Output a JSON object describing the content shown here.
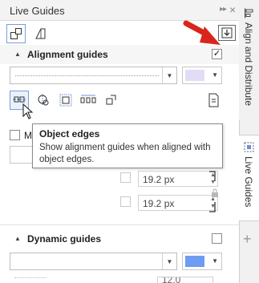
{
  "window": {
    "title": "Live Guides"
  },
  "side_tabs": {
    "align_distribute": "Align and Distribute",
    "live_guides": "Live Guides",
    "add": "+"
  },
  "alignment_section": {
    "label": "Alignment guides",
    "enabled": true,
    "checkbox_mark": "✓",
    "color_hex": "#e3dcf6"
  },
  "alignment_partial_label": "M",
  "tooltip": {
    "title": "Object edges",
    "description": "Show alignment guides when aligned with object edges."
  },
  "margins": {
    "value_1": "19.2 px",
    "value_2": "19.2 px"
  },
  "dynamic_section": {
    "label": "Dynamic guides",
    "enabled": false,
    "color_hex": "#6f9cf2",
    "partial_value": "12.0"
  },
  "icons": {
    "title_arrows": "▸▸",
    "close": "×",
    "caret_up": "▲",
    "caret_down": "▼"
  }
}
